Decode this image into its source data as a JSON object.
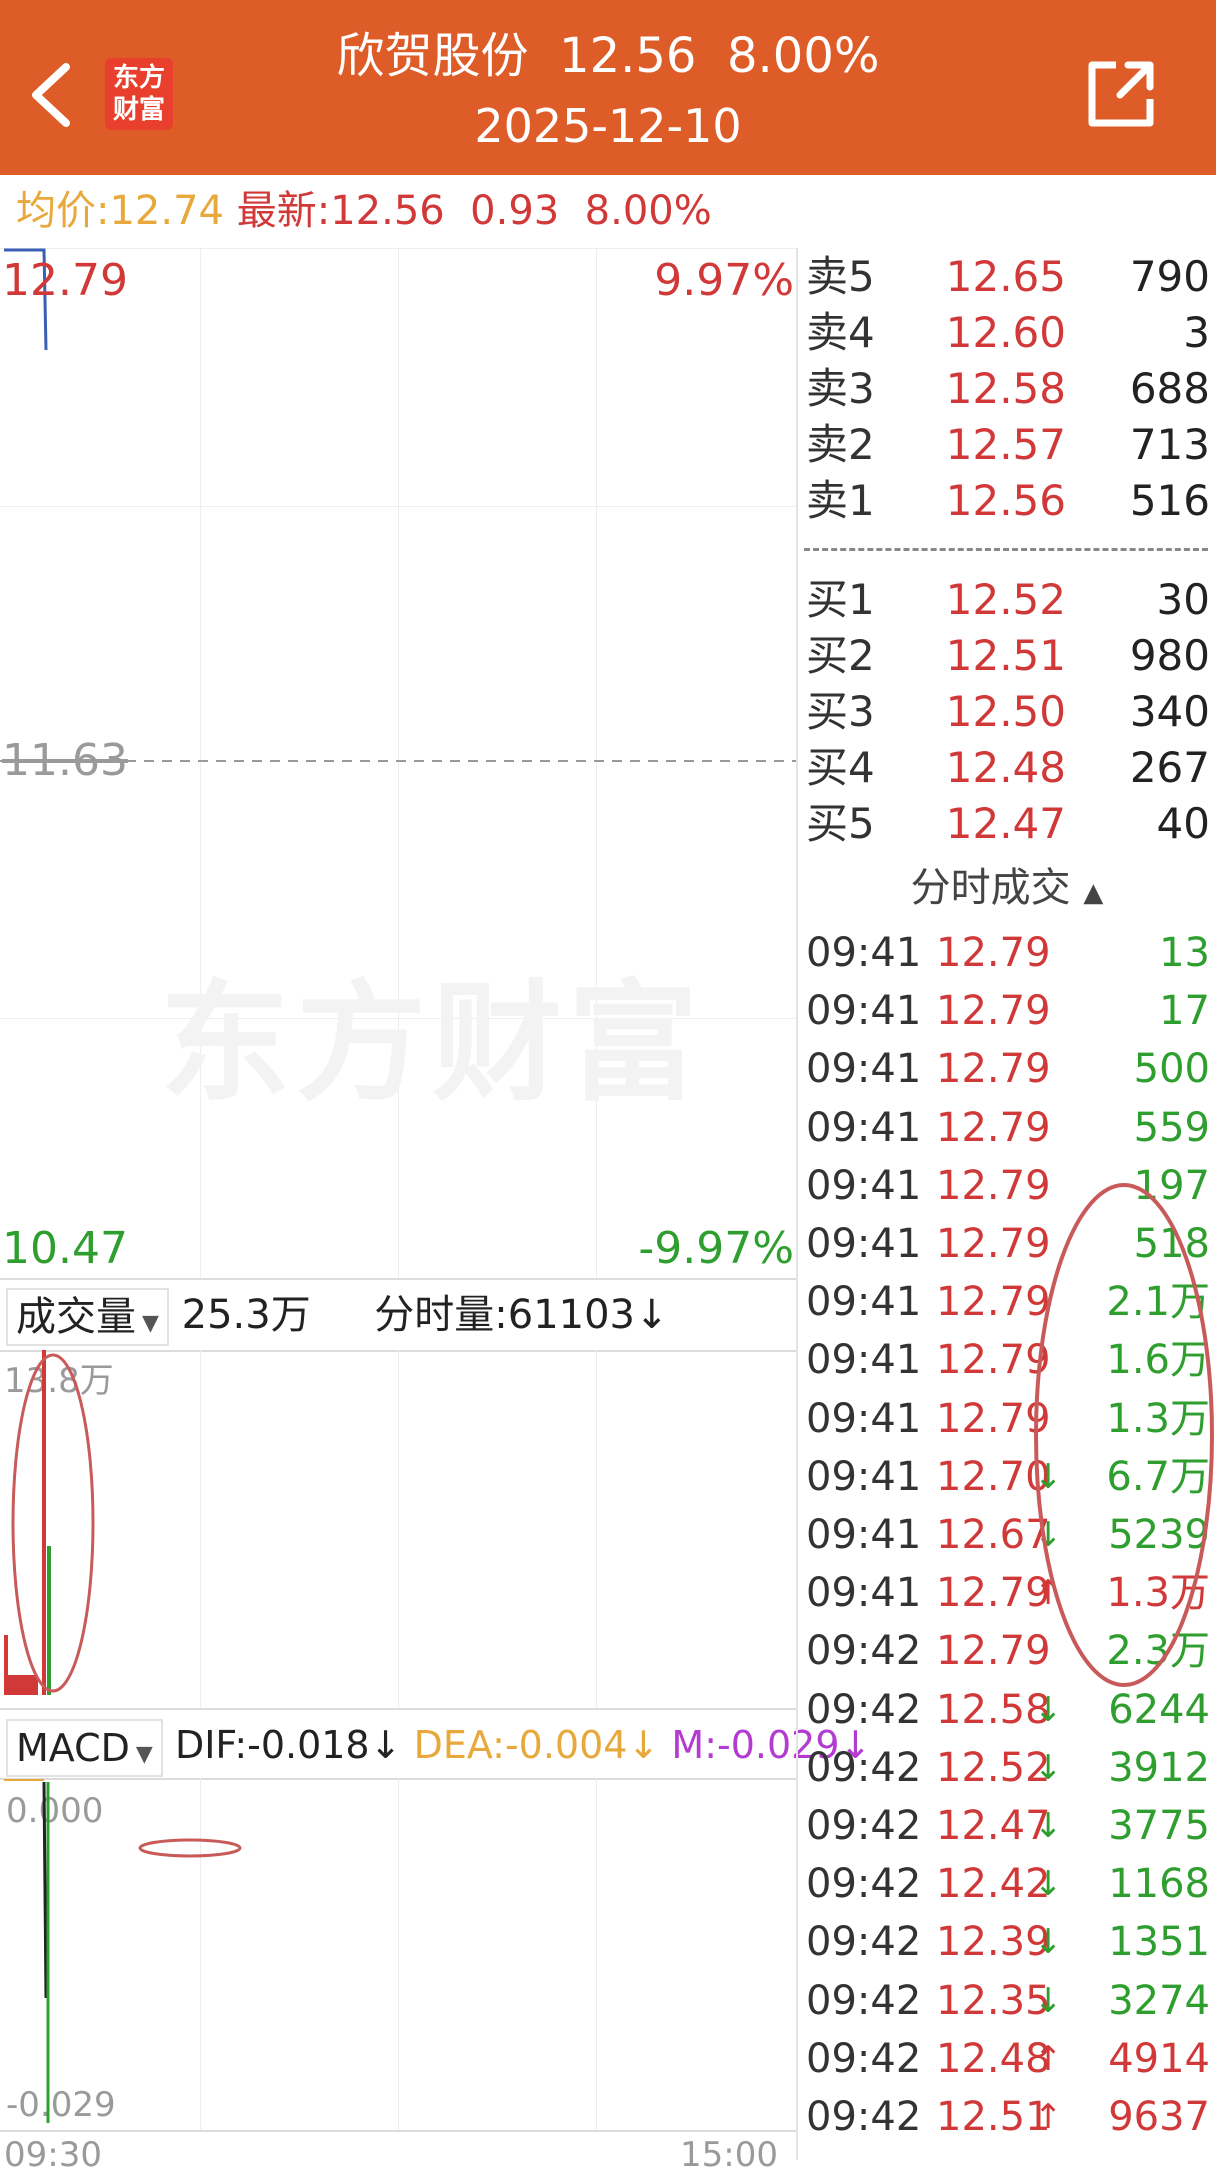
{
  "header": {
    "back_icon": "chevron-left-icon",
    "logo_line1": "东方",
    "logo_line2": "财富",
    "title": "欣贺股份  12.56  8.00%",
    "date": "2025-12-10",
    "share_icon": "share-external-icon"
  },
  "info": {
    "avg_label": "均价:",
    "avg_value": "12.74",
    "latest_label": "最新:",
    "latest_value": "12.56",
    "change": "0.93",
    "change_pct": "8.00%"
  },
  "price_chart": {
    "top_price": "12.79",
    "top_pct": "9.97%",
    "mid_price": "11.63",
    "bottom_price": "10.47",
    "bottom_pct": "-9.97%",
    "watermark": "东方财富"
  },
  "volume_panel": {
    "selector": "成交量",
    "total": "25.3万",
    "tick_volume": "分时量:61103",
    "tick_volume_arrow": "↓",
    "max_label": "13.8万"
  },
  "macd_panel": {
    "selector": "MACD",
    "dif": "DIF:-0.018",
    "dif_arrow": "↓",
    "dea": "DEA:-0.004",
    "dea_arrow": "↓",
    "m": "M:-0.029",
    "m_arrow": "↓",
    "top_label": "0.000",
    "bottom_label": "-0.029",
    "time_start": "09:30",
    "time_end": "15:00"
  },
  "orderbook": {
    "asks": [
      {
        "label": "卖5",
        "price": "12.65",
        "vol": "790"
      },
      {
        "label": "卖4",
        "price": "12.60",
        "vol": "3"
      },
      {
        "label": "卖3",
        "price": "12.58",
        "vol": "688"
      },
      {
        "label": "卖2",
        "price": "12.57",
        "vol": "713"
      },
      {
        "label": "卖1",
        "price": "12.56",
        "vol": "516"
      }
    ],
    "bids": [
      {
        "label": "买1",
        "price": "12.52",
        "vol": "30"
      },
      {
        "label": "买2",
        "price": "12.51",
        "vol": "980"
      },
      {
        "label": "买3",
        "price": "12.50",
        "vol": "340"
      },
      {
        "label": "买4",
        "price": "12.48",
        "vol": "267"
      },
      {
        "label": "买5",
        "price": "12.47",
        "vol": "40"
      }
    ]
  },
  "ticks": {
    "header": "分时成交",
    "rows": [
      {
        "time": "09:41",
        "price": "12.79",
        "arrow": "",
        "vol": "13",
        "vol_color": "green"
      },
      {
        "time": "09:41",
        "price": "12.79",
        "arrow": "",
        "vol": "17",
        "vol_color": "green"
      },
      {
        "time": "09:41",
        "price": "12.79",
        "arrow": "",
        "vol": "500",
        "vol_color": "green"
      },
      {
        "time": "09:41",
        "price": "12.79",
        "arrow": "",
        "vol": "559",
        "vol_color": "green"
      },
      {
        "time": "09:41",
        "price": "12.79",
        "arrow": "",
        "vol": "197",
        "vol_color": "green"
      },
      {
        "time": "09:41",
        "price": "12.79",
        "arrow": "",
        "vol": "518",
        "vol_color": "green"
      },
      {
        "time": "09:41",
        "price": "12.79",
        "arrow": "",
        "vol": "2.1万",
        "vol_color": "green"
      },
      {
        "time": "09:41",
        "price": "12.79",
        "arrow": "",
        "vol": "1.6万",
        "vol_color": "green"
      },
      {
        "time": "09:41",
        "price": "12.79",
        "arrow": "",
        "vol": "1.3万",
        "vol_color": "green"
      },
      {
        "time": "09:41",
        "price": "12.70",
        "arrow": "↓",
        "vol": "6.7万",
        "vol_color": "green"
      },
      {
        "time": "09:41",
        "price": "12.67",
        "arrow": "↓",
        "vol": "5239",
        "vol_color": "green"
      },
      {
        "time": "09:41",
        "price": "12.79",
        "arrow": "↑",
        "vol": "1.3万",
        "vol_color": "red"
      },
      {
        "time": "09:42",
        "price": "12.79",
        "arrow": "",
        "vol": "2.3万",
        "vol_color": "green"
      },
      {
        "time": "09:42",
        "price": "12.58",
        "arrow": "↓",
        "vol": "6244",
        "vol_color": "green"
      },
      {
        "time": "09:42",
        "price": "12.52",
        "arrow": "↓",
        "vol": "3912",
        "vol_color": "green"
      },
      {
        "time": "09:42",
        "price": "12.47",
        "arrow": "↓",
        "vol": "3775",
        "vol_color": "green"
      },
      {
        "time": "09:42",
        "price": "12.42",
        "arrow": "↓",
        "vol": "1168",
        "vol_color": "green"
      },
      {
        "time": "09:42",
        "price": "12.39",
        "arrow": "↓",
        "vol": "1351",
        "vol_color": "green"
      },
      {
        "time": "09:42",
        "price": "12.35",
        "arrow": "↓",
        "vol": "3274",
        "vol_color": "green"
      },
      {
        "time": "09:42",
        "price": "12.48",
        "arrow": "↑",
        "vol": "4914",
        "vol_color": "red"
      },
      {
        "time": "09:42",
        "price": "12.51",
        "arrow": "↑",
        "vol": "9637",
        "vol_color": "red"
      }
    ]
  },
  "colors": {
    "header_bg": "#dd5c28",
    "up_red": "#d13838",
    "down_green": "#2e9e2e",
    "avg_yellow": "#e8a93c",
    "macd_purple": "#b33bd0",
    "annotation_red": "#c95a5a"
  }
}
